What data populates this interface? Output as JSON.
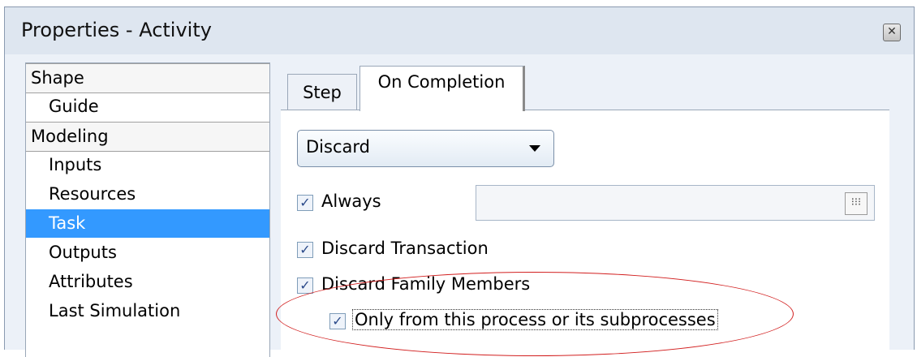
{
  "window": {
    "title": "Properties - Activity",
    "close_icon": "close-icon"
  },
  "nav": {
    "items": [
      {
        "label": "Shape",
        "kind": "group"
      },
      {
        "label": "Guide",
        "kind": "child"
      },
      {
        "label": "Modeling",
        "kind": "group"
      },
      {
        "label": "Inputs",
        "kind": "child"
      },
      {
        "label": "Resources",
        "kind": "child"
      },
      {
        "label": "Task",
        "kind": "child",
        "selected": true
      },
      {
        "label": "Outputs",
        "kind": "child"
      },
      {
        "label": "Attributes",
        "kind": "child"
      },
      {
        "label": "Last Simulation",
        "kind": "child"
      }
    ]
  },
  "tabs": [
    {
      "label": "Step",
      "active": false
    },
    {
      "label": "On Completion",
      "active": true
    }
  ],
  "panel": {
    "mode_select": {
      "value": "Discard"
    },
    "always": {
      "label": "Always",
      "checked": true,
      "field_value": "",
      "field_button_icon": "ellipsis-grid-icon"
    },
    "discard_transaction": {
      "label": "Discard Transaction",
      "checked": true
    },
    "discard_family": {
      "label": "Discard Family Members",
      "checked": true
    },
    "only_from_process": {
      "label": "Only from this process or its subprocesses",
      "checked": true
    }
  },
  "colors": {
    "selection": "#3399ff",
    "annotation": "#d21f1f"
  }
}
